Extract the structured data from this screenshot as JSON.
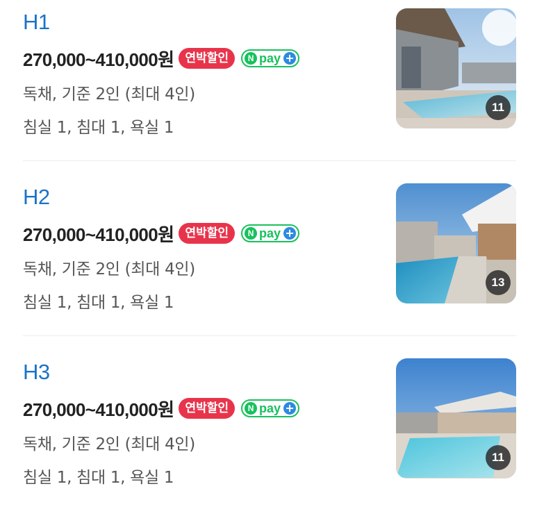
{
  "listings": [
    {
      "name": "H1",
      "price": "270,000~410,000원",
      "discount_badge": "연박할인",
      "npay_badge": "pay",
      "description": "독채, 기준 2인 (최대 4인)",
      "rooms": "침실 1, 침대 1, 욕실 1",
      "photo_count": "11"
    },
    {
      "name": "H2",
      "price": "270,000~410,000원",
      "discount_badge": "연박할인",
      "npay_badge": "pay",
      "description": "독채, 기준 2인 (최대 4인)",
      "rooms": "침실 1, 침대 1, 욕실 1",
      "photo_count": "13"
    },
    {
      "name": "H3",
      "price": "270,000~410,000원",
      "discount_badge": "연박할인",
      "npay_badge": "pay",
      "description": "독채, 기준 2인 (최대 4인)",
      "rooms": "침실 1, 침대 1, 욕실 1",
      "photo_count": "11"
    }
  ],
  "colors": {
    "title": "#1a73c8",
    "discount_badge": "#e8344b",
    "npay_green": "#18c15d",
    "npay_plus": "#2d8ae0"
  }
}
